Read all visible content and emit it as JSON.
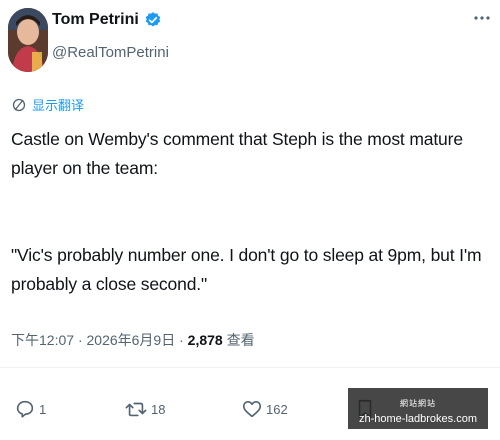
{
  "author": {
    "name": "Tom Petrini",
    "handle": "@RealTomPetrini"
  },
  "translate_label": "显示翻译",
  "tweet": {
    "lines": [
      "Castle on Wemby's comment that Steph is the most mature player on the team:",
      "\"Vic's probably number one. I don't go to sleep at 9pm, but I'm probably a close second.\""
    ]
  },
  "meta": {
    "time": "下午12:07",
    "date": "2026年6月9日",
    "views": "2,878",
    "views_label": "查看"
  },
  "actions": {
    "replies": "1",
    "reposts": "18",
    "likes": "162"
  },
  "watermark": {
    "badge": "網站網站",
    "domain": "zh-home-ladbrokes.com"
  },
  "colors": {
    "accent": "#1d9bf0",
    "text": "#0f1419",
    "muted": "#536471"
  },
  "icons": [
    "verified-badge-icon",
    "more-dots-icon",
    "translate-icon",
    "reply-icon",
    "repost-icon",
    "like-icon",
    "bookmark-icon"
  ]
}
